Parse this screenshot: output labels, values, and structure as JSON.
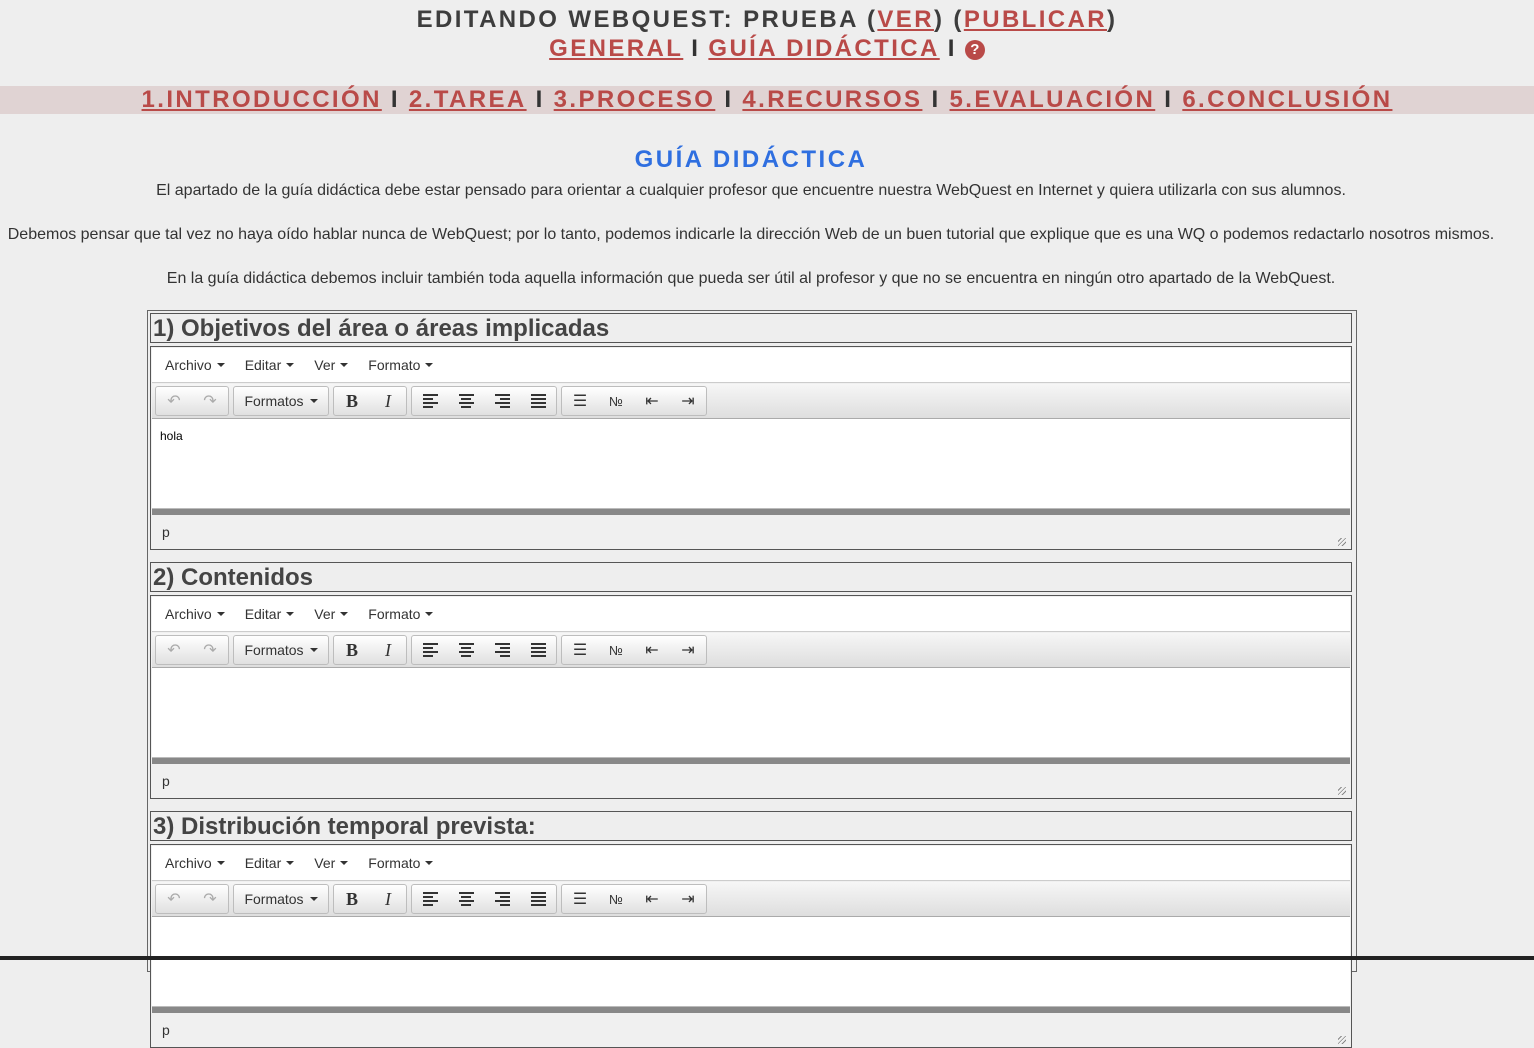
{
  "header": {
    "title_prefix": "EDITANDO WEBQUEST: PRUEBA (",
    "view_link": "VER",
    "mid": ") (",
    "publish_link": "PUBLICAR",
    "title_suffix": ")",
    "general_link": "GENERAL",
    "separator": "I",
    "guide_link": "GUÍA DIDÁCTICA",
    "help_icon": "?"
  },
  "nav": {
    "items": [
      "1.INTRODUCCIÓN",
      "2.TAREA",
      "3.PROCESO",
      "4.RECURSOS",
      "5.EVALUACIÓN",
      "6.CONCLUSIÓN"
    ],
    "separator": "I"
  },
  "main": {
    "title": "GUÍA DIDÁCTICA",
    "paragraphs": [
      "El apartado de la guía didáctica debe estar pensado para orientar a cualquier profesor que encuentre nuestra WebQuest en Internet y quiera utilizarla con sus alumnos.",
      "Debemos pensar que tal vez no haya oído hablar nunca de WebQuest; por lo tanto, podemos indicarle la dirección Web de un buen tutorial que explique que es una WQ o podemos redactarlo nosotros mismos.",
      "En la guía didáctica debemos incluir también toda aquella información que pueda ser útil al profesor y que no se encuentra en ningún otro apartado de la WebQuest."
    ]
  },
  "editor_ui": {
    "menus": [
      "Archivo",
      "Editar",
      "Ver",
      "Formato"
    ],
    "formats_label": "Formatos",
    "bold_label": "B",
    "italic_label": "I",
    "status_path": "p",
    "icons": [
      "undo-icon",
      "redo-icon",
      "align-left-icon",
      "align-center-icon",
      "align-right-icon",
      "align-justify-icon",
      "bullet-list-icon",
      "numbered-list-icon",
      "outdent-icon",
      "indent-icon",
      "resize-grip-icon"
    ]
  },
  "blocks": [
    {
      "title": "1) Objetivos del área o áreas implicadas",
      "content": "hola"
    },
    {
      "title": "2) Contenidos",
      "content": ""
    },
    {
      "title": "3) Distribución temporal prevista:",
      "content": ""
    }
  ],
  "colors": {
    "link": "#b94a48",
    "heading_blue": "#2f6fe0",
    "nav_band": "#e0d3d3",
    "background": "#eeeeee"
  }
}
